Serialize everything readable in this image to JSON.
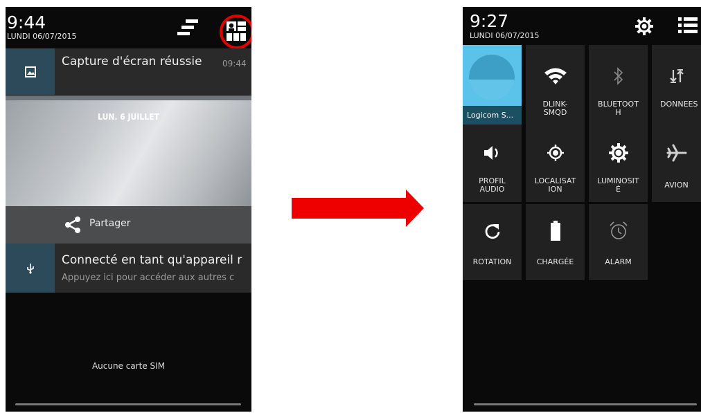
{
  "left_screen": {
    "status": {
      "time": "9:44",
      "date": "LUNDI 06/07/2015"
    },
    "notifications": [
      {
        "title": "Capture d'écran réussie",
        "time": "09:44",
        "icon": "image-icon"
      },
      {
        "title": "Connecté en tant qu'appareil r",
        "subtitle": "Appuyez ici pour accéder aux autres c",
        "icon": "usb-icon"
      }
    ],
    "screenshot_preview": {
      "label": "LUN. 6 JUILLET"
    },
    "share": {
      "label": "Partager",
      "icon": "share-icon"
    },
    "sim_status": "Aucune carte SIM",
    "header_icons": [
      "clear-all-icon",
      "quick-settings-icon"
    ]
  },
  "right_screen": {
    "status": {
      "time": "9:27",
      "date": "LUNDI 06/07/2015"
    },
    "header_icons": [
      "settings-icon",
      "notifications-list-icon"
    ],
    "tiles": [
      {
        "label": "Logicom S...",
        "icon": "user-icon"
      },
      {
        "label": "DLINK-\nSMQD",
        "icon": "wifi-icon"
      },
      {
        "label": "BLUETOOT\nH",
        "icon": "bluetooth-icon"
      },
      {
        "label": "DONNEES",
        "icon": "data-icon"
      },
      {
        "label": "PROFIL\nAUDIO",
        "icon": "volume-icon"
      },
      {
        "label": "LOCALISAT\nION",
        "icon": "location-icon"
      },
      {
        "label": "LUMINOSIT\nÉ",
        "icon": "brightness-icon"
      },
      {
        "label": "AVION",
        "icon": "airplane-icon"
      },
      {
        "label": "ROTATION",
        "icon": "rotation-icon"
      },
      {
        "label": "CHARGÉE",
        "icon": "battery-icon"
      },
      {
        "label": "ALARM",
        "icon": "alarm-icon"
      }
    ]
  },
  "colors": {
    "highlight_ring": "#e00000",
    "arrow": "#ee0000",
    "accent_tile": "#5bc3ea"
  }
}
